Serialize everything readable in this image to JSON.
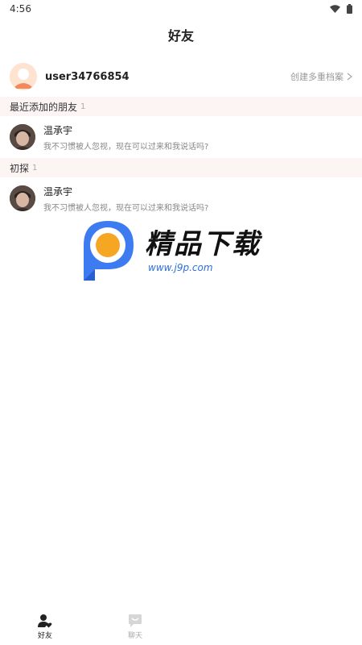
{
  "status": {
    "time": "4:56"
  },
  "header": {
    "title": "好友"
  },
  "profile": {
    "username": "user34766854",
    "link_label": "创建多重档案"
  },
  "sections": [
    {
      "title": "最近添加的朋友",
      "count": "1",
      "items": [
        {
          "name": "温承宇",
          "message": "我不习惯被人忽视，现在可以过来和我说话吗?"
        }
      ]
    },
    {
      "title": "初探",
      "count": "1",
      "items": [
        {
          "name": "温承宇",
          "message": "我不习惯被人忽视，现在可以过来和我说话吗?"
        }
      ]
    }
  ],
  "watermark": {
    "title": "精品下载",
    "url": "www.j9p.com"
  },
  "tabbar": {
    "tabs": [
      {
        "label": "好友",
        "active": true,
        "icon": "friends-icon"
      },
      {
        "label": "聊天",
        "active": false,
        "icon": "chat-icon"
      }
    ]
  },
  "colors": {
    "section_bg": "#fdf5f4",
    "active_tab": "#222222",
    "inactive_tab": "#bbbbbb",
    "brand_blue": "#2b6fe0",
    "brand_orange": "#f5a623"
  }
}
